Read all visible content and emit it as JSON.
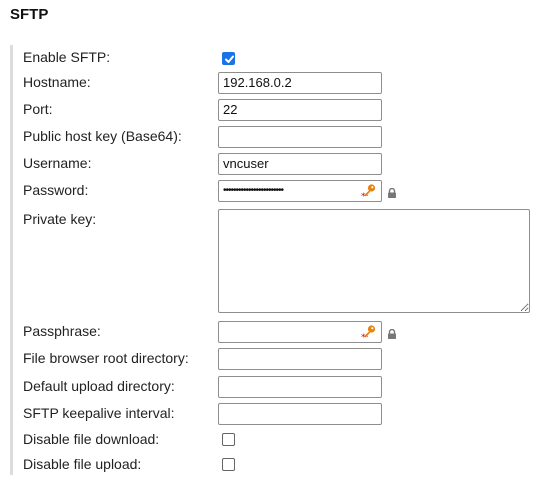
{
  "section": {
    "title": "SFTP"
  },
  "fields": {
    "enable_sftp": {
      "label": "Enable SFTP:",
      "checked": true
    },
    "hostname": {
      "label": "Hostname:",
      "value": "192.168.0.2"
    },
    "port": {
      "label": "Port:",
      "value": "22"
    },
    "public_host_key": {
      "label": "Public host key (Base64):",
      "value": ""
    },
    "username": {
      "label": "Username:",
      "value": "vncuser"
    },
    "password": {
      "label": "Password:",
      "value": "••••••••••••••••••••••••"
    },
    "private_key": {
      "label": "Private key:",
      "value": ""
    },
    "passphrase": {
      "label": "Passphrase:",
      "value": ""
    },
    "file_browser_root": {
      "label": "File browser root directory:",
      "value": ""
    },
    "default_upload_dir": {
      "label": "Default upload directory:",
      "value": ""
    },
    "keepalive_interval": {
      "label": "SFTP keepalive interval:",
      "value": ""
    },
    "disable_download": {
      "label": "Disable file download:",
      "checked": false
    },
    "disable_upload": {
      "label": "Disable file upload:",
      "checked": false
    }
  },
  "icons": {
    "key": "key-icon",
    "lock": "lock-icon",
    "check": "check-icon"
  },
  "colors": {
    "checkbox_accent": "#1a73e8",
    "key_orange": "#e8820e",
    "key_asterisk": "#d0021b",
    "lock_grey": "#777777"
  }
}
